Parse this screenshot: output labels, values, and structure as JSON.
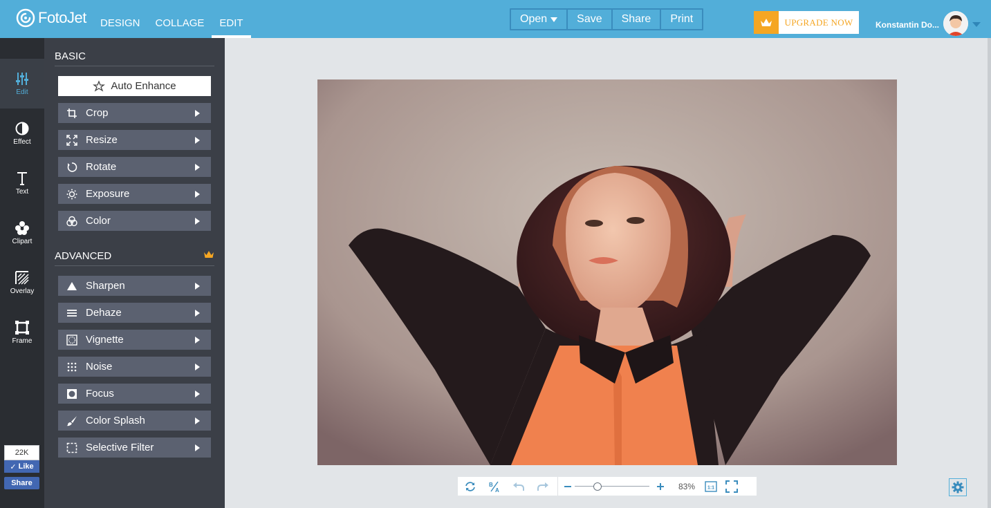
{
  "app": {
    "name": "FotoJet",
    "nav": [
      {
        "label": "DESIGN"
      },
      {
        "label": "COLLAGE"
      },
      {
        "label": "EDIT"
      }
    ]
  },
  "file_menu": {
    "open": "Open",
    "save": "Save",
    "share": "Share",
    "print": "Print"
  },
  "upgrade": {
    "label": "UPGRADE NOW"
  },
  "user": {
    "name": "Konstantin Do..."
  },
  "rail": [
    {
      "label": "Edit",
      "icon": "sliders-icon"
    },
    {
      "label": "Effect",
      "icon": "half-circle-icon"
    },
    {
      "label": "Text",
      "icon": "text-icon"
    },
    {
      "label": "Clipart",
      "icon": "flower-icon"
    },
    {
      "label": "Overlay",
      "icon": "hatch-icon"
    },
    {
      "label": "Frame",
      "icon": "frame-icon"
    }
  ],
  "facebook": {
    "count": "22K",
    "like": "Like",
    "share": "Share"
  },
  "panel": {
    "basic_heading": "BASIC",
    "auto_enhance": "Auto Enhance",
    "basic_tools": [
      {
        "label": "Crop",
        "icon": "crop-icon"
      },
      {
        "label": "Resize",
        "icon": "resize-icon"
      },
      {
        "label": "Rotate",
        "icon": "rotate-icon"
      },
      {
        "label": "Exposure",
        "icon": "sun-icon"
      },
      {
        "label": "Color",
        "icon": "color-circles-icon"
      }
    ],
    "advanced_heading": "ADVANCED",
    "advanced_tools": [
      {
        "label": "Sharpen",
        "icon": "triangle-icon"
      },
      {
        "label": "Dehaze",
        "icon": "lines-icon"
      },
      {
        "label": "Vignette",
        "icon": "vignette-icon"
      },
      {
        "label": "Noise",
        "icon": "dots-grid-icon"
      },
      {
        "label": "Focus",
        "icon": "focus-icon"
      },
      {
        "label": "Color Splash",
        "icon": "brush-icon"
      },
      {
        "label": "Selective Filter",
        "icon": "dashed-square-icon"
      }
    ]
  },
  "zoom": {
    "percent": "83%",
    "ratio": "1:1",
    "level": 0.28
  },
  "colors": {
    "topbar": "#52aed9",
    "rail": "#2a2d32",
    "panel": "#3b3f47",
    "tool": "#5b6170",
    "accent_orange": "#f5a623"
  }
}
